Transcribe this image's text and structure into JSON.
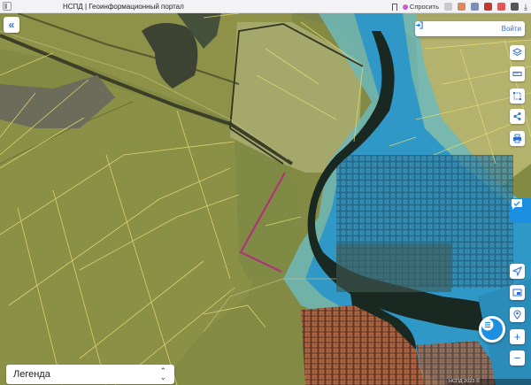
{
  "browser": {
    "tab_title": "НСПД | Геоинформационный портал",
    "ask_label": "Спросить"
  },
  "map": {
    "login_label": "Войти",
    "legend_label": "Легенда",
    "copyright": "НСПД 2023 ©",
    "colors": {
      "field": "#8f9347",
      "field_light": "#b0b06a",
      "water_zone": "#39a3c9",
      "water_zone_outer": "#7fc6c9",
      "river": "#1c2a24",
      "parcel_line": "#e8d870",
      "selected_parcel": "#b0337a",
      "building_fill": "#b0663f",
      "accent": "#1d8fe0"
    },
    "icons": {
      "collapse": "double-chevron-left-icon",
      "login": "login-arrow-icon",
      "layers": "layers-icon",
      "ruler": "ruler-icon",
      "area": "area-measure-icon",
      "share": "share-icon",
      "print": "print-icon",
      "side_tab": "feedback-icon",
      "navigate": "navigate-arrow-icon",
      "screen": "screen-icon",
      "location": "location-icon",
      "zoom_in": "zoom-in-icon",
      "zoom_out": "zoom-out-icon",
      "menu": "list-menu-icon"
    },
    "zoom_in_label": "+",
    "zoom_out_label": "−"
  }
}
